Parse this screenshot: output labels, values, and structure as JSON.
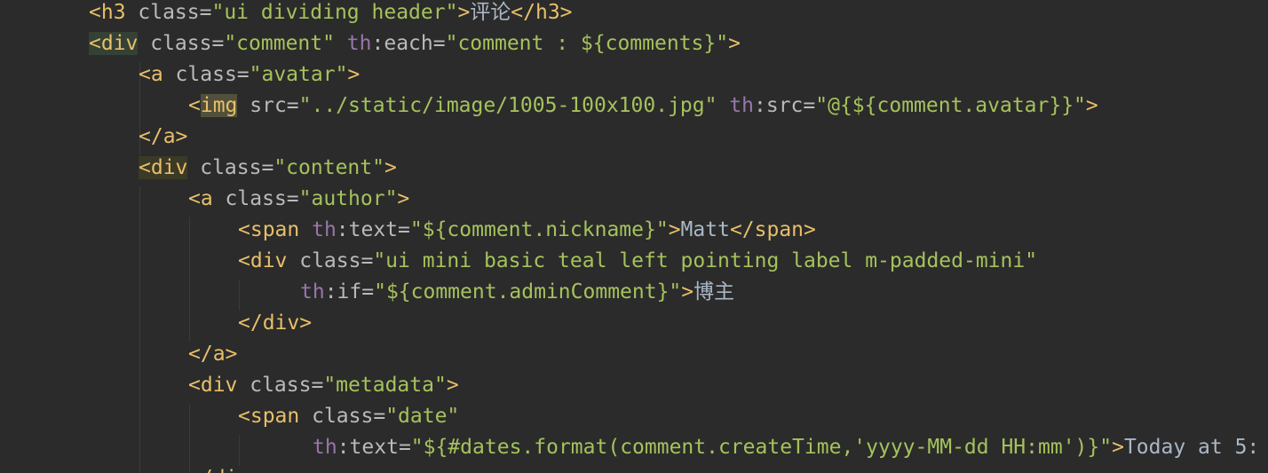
{
  "editor": {
    "lines": [
      {
        "parts": [
          {
            "t": "<h3",
            "c": "tag"
          },
          {
            "t": " class=",
            "c": "attr"
          },
          {
            "t": "\"ui dividing header\"",
            "c": "str"
          },
          {
            "t": ">",
            "c": "tag"
          },
          {
            "t": "评论",
            "c": "txt"
          },
          {
            "t": "</h3>",
            "c": "tag"
          }
        ]
      },
      {
        "parts": [
          {
            "t": "<div",
            "c": "tag hl-div"
          },
          {
            "t": " class=",
            "c": "attr"
          },
          {
            "t": "\"comment\"",
            "c": "str"
          },
          {
            "t": " th",
            "c": "ns"
          },
          {
            "t": ":each=",
            "c": "attr"
          },
          {
            "t": "\"comment : ${comments}\"",
            "c": "str"
          },
          {
            "t": ">",
            "c": "tag"
          }
        ]
      },
      {
        "parts": [
          {
            "t": "<a",
            "c": "tag"
          },
          {
            "t": " class=",
            "c": "attr"
          },
          {
            "t": "\"avatar\"",
            "c": "str"
          },
          {
            "t": ">",
            "c": "tag"
          }
        ]
      },
      {
        "parts": [
          {
            "t": "<",
            "c": "tag"
          },
          {
            "t": "img",
            "c": "tag hl-img"
          },
          {
            "t": " src=",
            "c": "attr"
          },
          {
            "t": "\"../static/image/1005-100x100.jpg\"",
            "c": "str"
          },
          {
            "t": " th",
            "c": "ns"
          },
          {
            "t": ":src=",
            "c": "attr"
          },
          {
            "t": "\"@{${comment.avatar}}\"",
            "c": "str"
          },
          {
            "t": ">",
            "c": "tag"
          }
        ]
      },
      {
        "parts": [
          {
            "t": "</a>",
            "c": "tag"
          }
        ]
      },
      {
        "parts": [
          {
            "t": "<div",
            "c": "tag hl-div2"
          },
          {
            "t": " class=",
            "c": "attr"
          },
          {
            "t": "\"content\"",
            "c": "str"
          },
          {
            "t": ">",
            "c": "tag"
          }
        ]
      },
      {
        "parts": [
          {
            "t": "<a",
            "c": "tag"
          },
          {
            "t": " class=",
            "c": "attr"
          },
          {
            "t": "\"author\"",
            "c": "str"
          },
          {
            "t": ">",
            "c": "tag"
          }
        ]
      },
      {
        "parts": [
          {
            "t": "<span",
            "c": "tag"
          },
          {
            "t": " th",
            "c": "ns"
          },
          {
            "t": ":text=",
            "c": "attr"
          },
          {
            "t": "\"${comment.nickname}\"",
            "c": "str"
          },
          {
            "t": ">",
            "c": "tag"
          },
          {
            "t": "Matt",
            "c": "txt"
          },
          {
            "t": "</span>",
            "c": "tag"
          }
        ]
      },
      {
        "parts": [
          {
            "t": "<div",
            "c": "tag"
          },
          {
            "t": " class=",
            "c": "attr"
          },
          {
            "t": "\"ui mini basic teal left pointing label m-padded-mini\"",
            "c": "str"
          }
        ]
      },
      {
        "parts": [
          {
            "t": "th",
            "c": "ns"
          },
          {
            "t": ":if=",
            "c": "attr"
          },
          {
            "t": "\"${comment.adminComment}\"",
            "c": "str"
          },
          {
            "t": ">",
            "c": "tag"
          },
          {
            "t": "博主",
            "c": "txt"
          }
        ]
      },
      {
        "parts": [
          {
            "t": "</div>",
            "c": "tag"
          }
        ]
      },
      {
        "parts": [
          {
            "t": "</a>",
            "c": "tag"
          }
        ]
      },
      {
        "parts": [
          {
            "t": "<div",
            "c": "tag"
          },
          {
            "t": " class=",
            "c": "attr"
          },
          {
            "t": "\"metadata\"",
            "c": "str"
          },
          {
            "t": ">",
            "c": "tag"
          }
        ]
      },
      {
        "parts": [
          {
            "t": "<span",
            "c": "tag"
          },
          {
            "t": " class=",
            "c": "attr"
          },
          {
            "t": "\"date\"",
            "c": "str"
          }
        ]
      },
      {
        "parts": [
          {
            "t": "th",
            "c": "ns"
          },
          {
            "t": ":text=",
            "c": "attr"
          },
          {
            "t": "\"${#dates.format(comment.createTime,'yyyy-MM-dd HH:mm')}\"",
            "c": "str"
          },
          {
            "t": ">",
            "c": "tag"
          },
          {
            "t": "Today at 5:",
            "c": "txt"
          }
        ]
      },
      {
        "parts": [
          {
            "t": "</di",
            "c": "tag"
          }
        ]
      }
    ]
  }
}
